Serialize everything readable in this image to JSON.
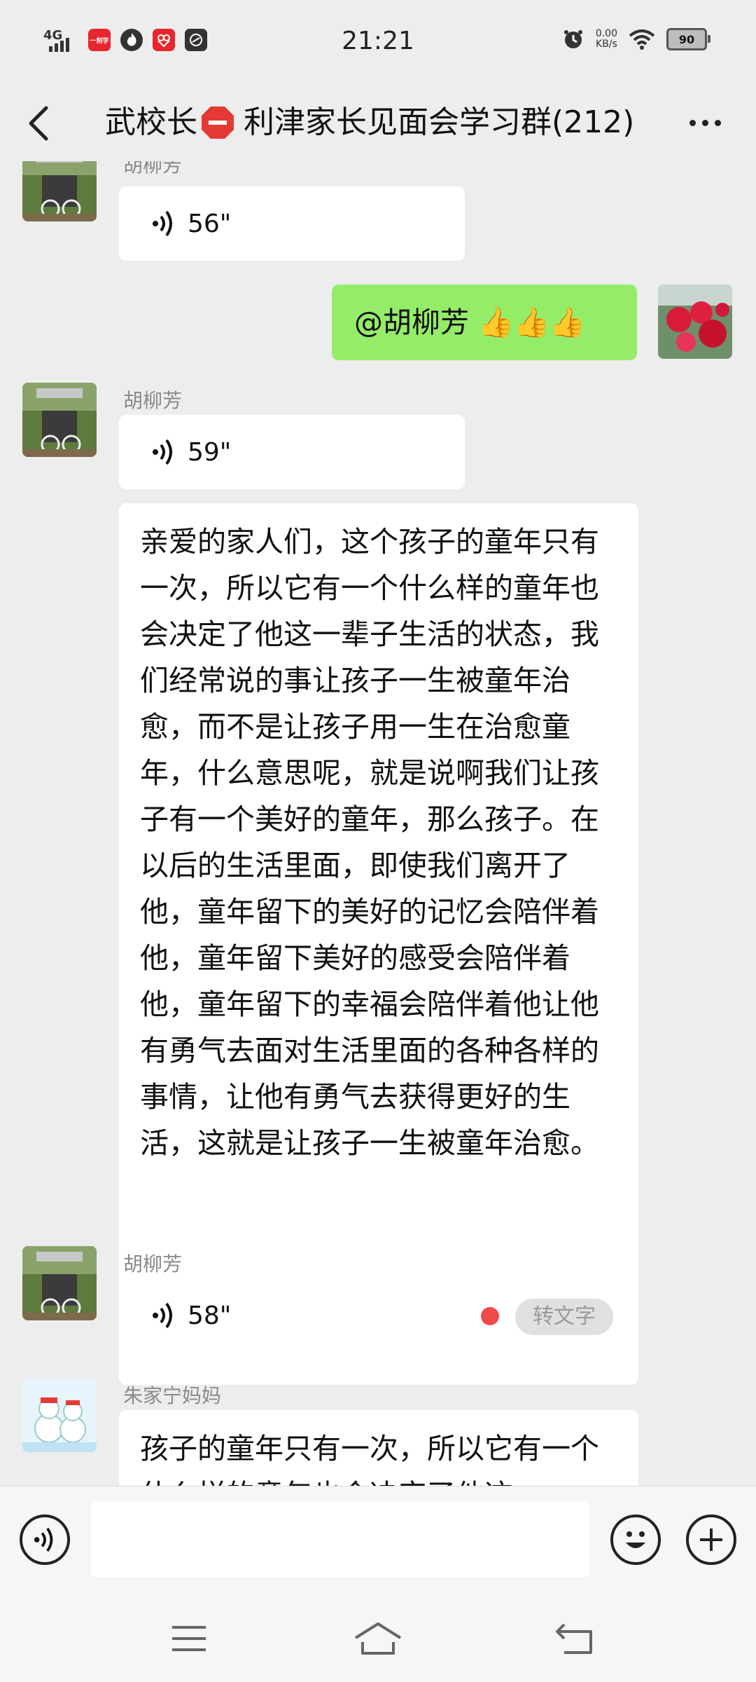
{
  "status_bar": {
    "network": "4G",
    "app1_label": "一刻字",
    "time": "21:21",
    "speed_value": "0.00",
    "speed_unit": "KB/s",
    "battery": "90"
  },
  "header": {
    "title_part1": "武校长",
    "title_part2": "利津家长见面会学习群(212)"
  },
  "messages": [
    {
      "sender": "胡柳芳",
      "type": "voice",
      "duration": "56\""
    },
    {
      "type": "text",
      "text": "@胡柳芳 👍👍👍"
    },
    {
      "sender": "胡柳芳",
      "type": "voice",
      "duration": "59\""
    },
    {
      "type": "text",
      "text": "亲爱的家人们，这个孩子的童年只有一次，所以它有一个什么样的童年也会决定了他这一辈子生活的状态，我们经常说的事让孩子一生被童年治愈，而不是让孩子用一生在治愈童年，什么意思呢，就是说啊我们让孩子有一个美好的童年，那么孩子。在以后的生活里面，即使我们离开了他，童年留下的美好的记忆会陪伴着他，童年留下美好的感受会陪伴着他，童年留下的幸福会陪伴着他让他有勇气去面对生活里面的各种各样的事情，让他有勇气去获得更好的生活，这就是让孩子一生被童年治愈。"
    },
    {
      "sender": "胡柳芳",
      "type": "voice",
      "duration": "58\"",
      "action": "转文字"
    },
    {
      "sender": "朱家宁妈妈",
      "type": "text",
      "text": "孩子的童年只有一次，所以它有一个什么样的童年也会决定了他这"
    }
  ],
  "colors": {
    "background": "#ededed",
    "self_bubble": "#95ec69",
    "other_bubble": "#ffffff",
    "unread_dot": "#f04a4a"
  },
  "icons": {
    "back": "back-arrow-icon",
    "more": "more-icon",
    "voice": "voice-icon",
    "emoji": "emoji-icon",
    "plus": "plus-icon",
    "menu": "menu-icon",
    "home": "home-icon",
    "return": "return-icon"
  }
}
